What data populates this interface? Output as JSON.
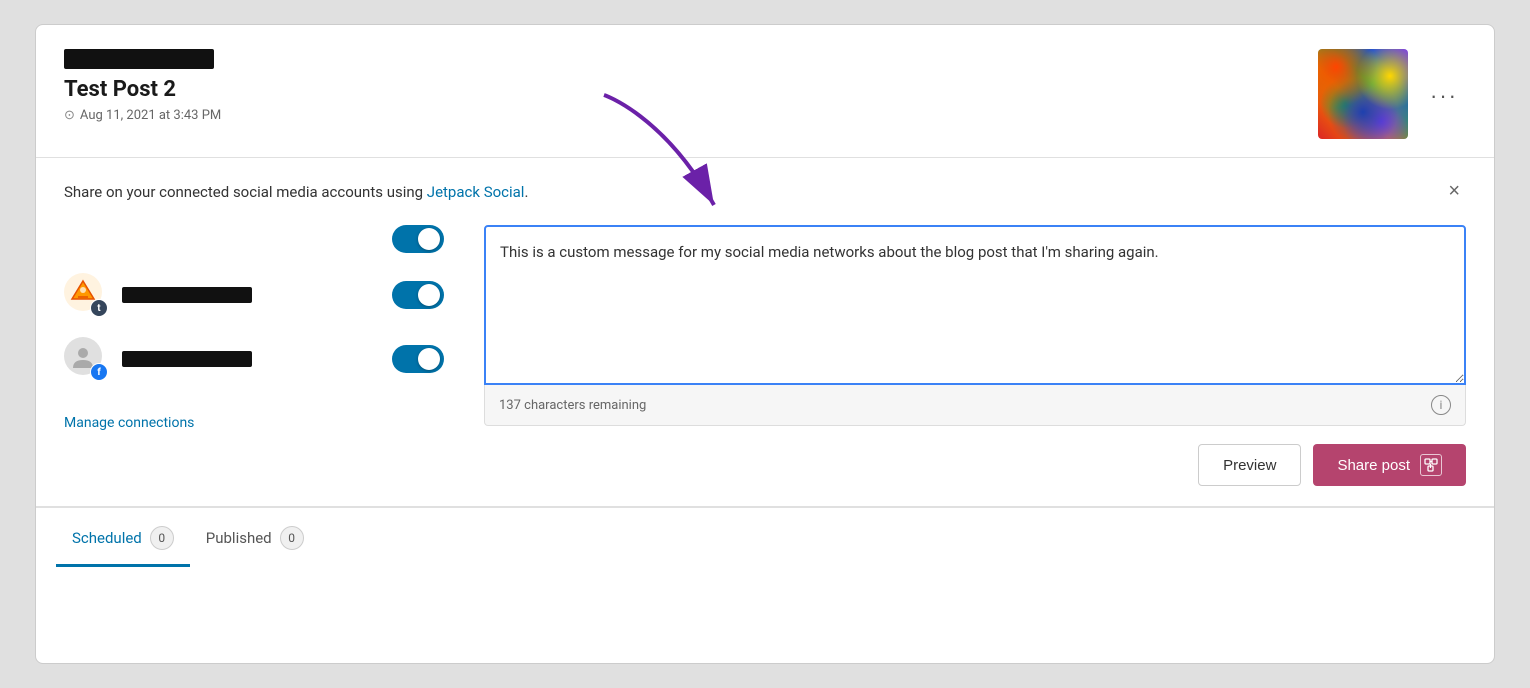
{
  "post": {
    "title": "Test Post 2",
    "date": "Aug 11, 2021 at 3:43 PM",
    "more_label": "···"
  },
  "share_section": {
    "info_text_prefix": "Share on your connected social media accounts using ",
    "info_link": "Jetpack Social",
    "info_text_suffix": ".",
    "close_label": "×"
  },
  "connections": [
    {
      "type": "standalone_toggle"
    },
    {
      "avatar_type": "tumblr",
      "platform": "tumblr",
      "badge_label": "t",
      "enabled": true
    },
    {
      "avatar_type": "facebook",
      "platform": "facebook",
      "badge_label": "f",
      "enabled": true
    }
  ],
  "message": {
    "text": "This is a custom message for my social media networks about the blog post that I'm sharing again.",
    "char_remaining": "137 characters remaining"
  },
  "buttons": {
    "preview_label": "Preview",
    "share_label": "Share post"
  },
  "manage_connections": {
    "label": "Manage connections"
  },
  "footer_tabs": [
    {
      "label": "Scheduled",
      "count": "0",
      "active": true
    },
    {
      "label": "Published",
      "count": "0",
      "active": false
    }
  ]
}
